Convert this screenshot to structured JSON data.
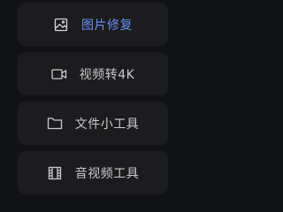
{
  "menu": {
    "accent_color": "#6b8ff2",
    "items": [
      {
        "label": "图片修复",
        "icon": "image-icon",
        "active": true
      },
      {
        "label": "视频转4K",
        "icon": "video-camera-icon",
        "active": false
      },
      {
        "label": "文件小工具",
        "icon": "folder-icon",
        "active": false
      },
      {
        "label": "音视频工具",
        "icon": "film-icon",
        "active": false
      }
    ]
  }
}
